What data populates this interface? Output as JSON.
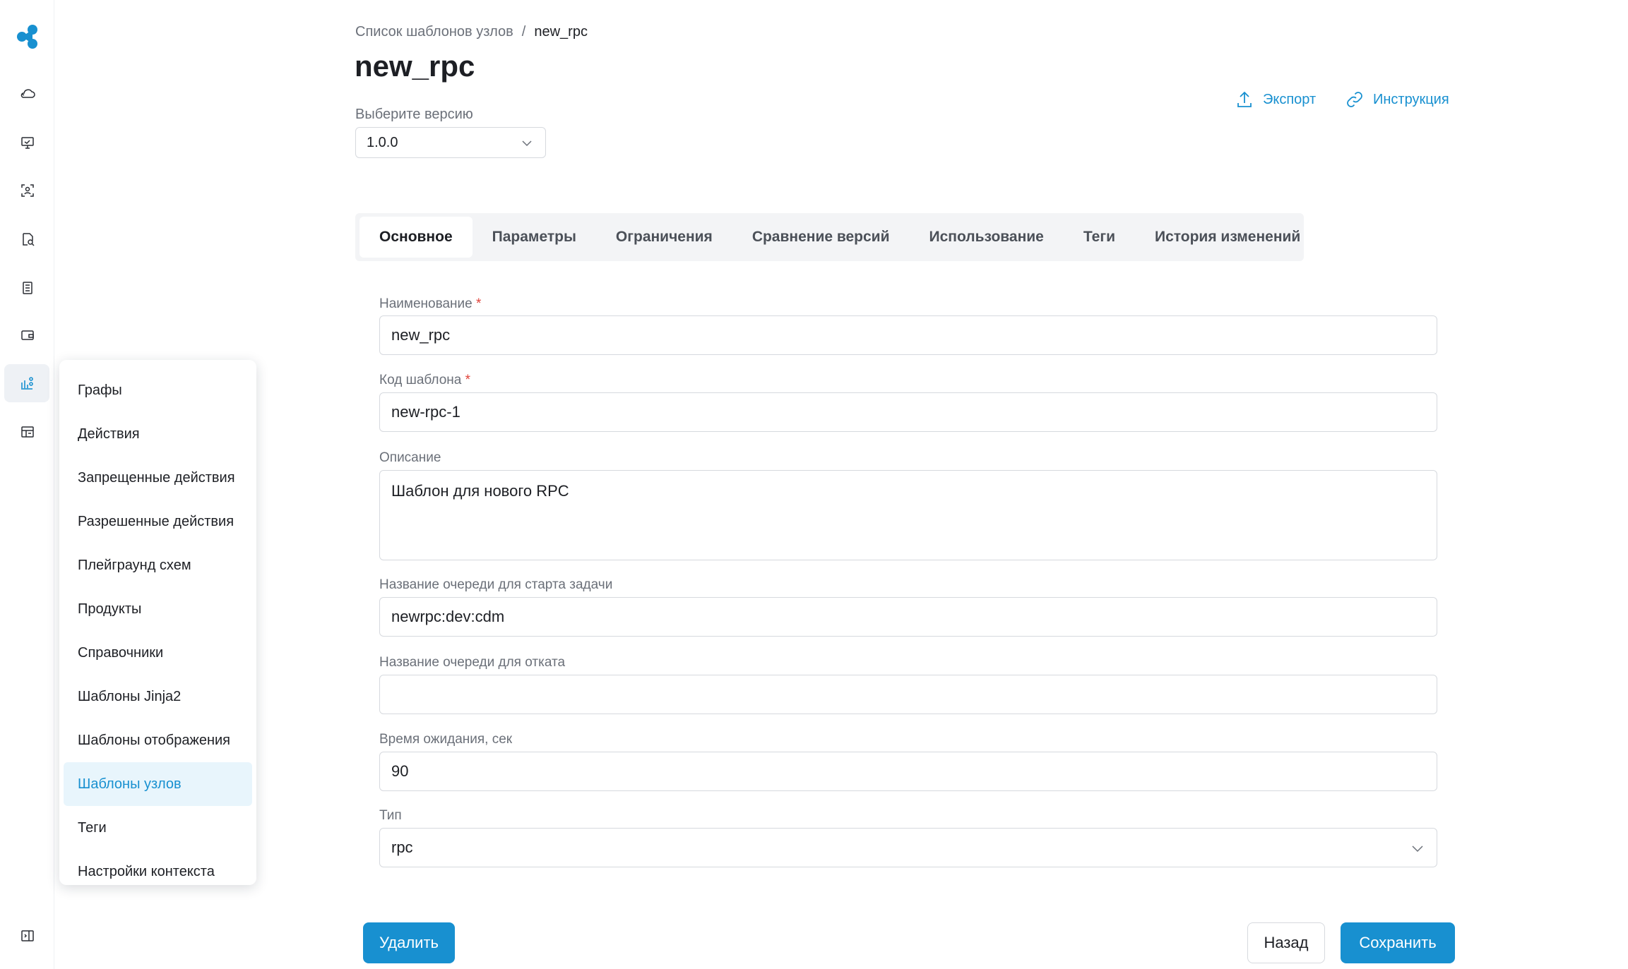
{
  "rail": {
    "icons": [
      {
        "name": "cloud-upload-icon"
      },
      {
        "name": "monitor-icon"
      },
      {
        "name": "scan-user-icon"
      },
      {
        "name": "document-search-icon"
      },
      {
        "name": "list-document-icon"
      },
      {
        "name": "wallet-icon"
      },
      {
        "name": "chart-nodes-icon"
      },
      {
        "name": "grid-settings-icon"
      },
      {
        "name": "collapse-panel-icon"
      }
    ]
  },
  "flyout": {
    "items": [
      {
        "label": "Графы"
      },
      {
        "label": "Действия"
      },
      {
        "label": "Запрещенные действия"
      },
      {
        "label": "Разрешенные действия"
      },
      {
        "label": "Плейграунд схем"
      },
      {
        "label": "Продукты"
      },
      {
        "label": "Справочники"
      },
      {
        "label": "Шаблоны Jinja2"
      },
      {
        "label": "Шаблоны отображения"
      },
      {
        "label": "Шаблоны узлов"
      },
      {
        "label": "Теги"
      },
      {
        "label": "Настройки контекста"
      }
    ],
    "active_index": 9
  },
  "header": {
    "breadcrumb_parent": "Список шаблонов узлов",
    "breadcrumb_sep": "/",
    "breadcrumb_current": "new_rpc",
    "title": "new_rpc",
    "version_label": "Выберите версию",
    "version_value": "1.0.0",
    "export_label": "Экспорт",
    "instruction_label": "Инструкция"
  },
  "tabs": [
    {
      "label": "Основное"
    },
    {
      "label": "Параметры"
    },
    {
      "label": "Ограничения"
    },
    {
      "label": "Сравнение версий"
    },
    {
      "label": "Использование"
    },
    {
      "label": "Теги"
    },
    {
      "label": "История изменений"
    }
  ],
  "form": {
    "name_label": "Наименование",
    "name_value": "new_rpc",
    "code_label": "Код шаблона",
    "code_value": "new-rpc-1",
    "required_mark": "*",
    "description_label": "Описание",
    "description_value": "Шаблон для нового RPC",
    "start_queue_label": "Название очереди для старта задачи",
    "start_queue_value": "newrpc:dev:cdm",
    "rollback_queue_label": "Название очереди для отката",
    "rollback_queue_value": "",
    "timeout_label": "Время ожидания, сек",
    "timeout_value": "90",
    "type_label": "Тип",
    "type_value": "rpc"
  },
  "buttons": {
    "delete": "Удалить",
    "back": "Назад",
    "save": "Сохранить"
  },
  "colors": {
    "accent": "#1890d0",
    "required": "#e0433a"
  }
}
